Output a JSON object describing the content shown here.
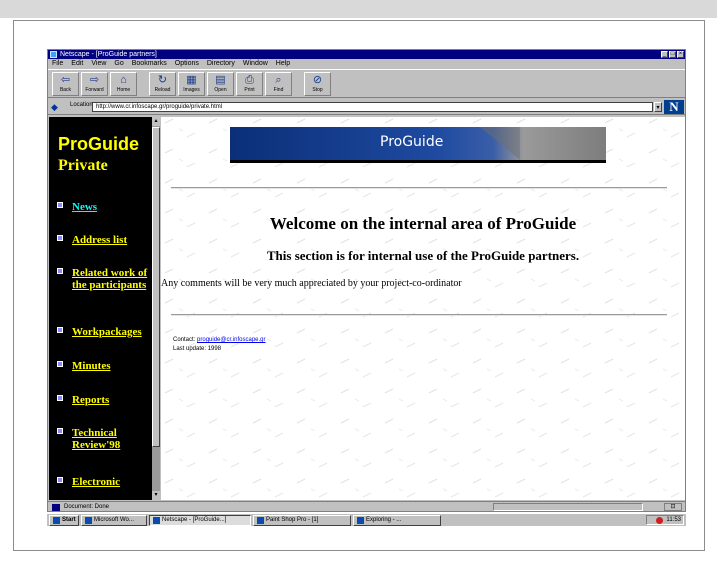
{
  "window": {
    "title": "Netscape - [ProGuide partners]",
    "controls": [
      "_",
      "□",
      "×"
    ]
  },
  "menu": [
    "File",
    "Edit",
    "View",
    "Go",
    "Bookmarks",
    "Options",
    "Directory",
    "Window",
    "Help"
  ],
  "toolbar": {
    "buttons": [
      {
        "label": "Back",
        "icon": "back-arrow-icon",
        "glyph": "⇦"
      },
      {
        "label": "Forward",
        "icon": "forward-arrow-icon",
        "glyph": "⇨"
      },
      {
        "label": "Home",
        "icon": "home-icon",
        "glyph": "⌂"
      },
      {
        "label": "Reload",
        "icon": "reload-icon",
        "glyph": "↻"
      },
      {
        "label": "Images",
        "icon": "images-icon",
        "glyph": "▦"
      },
      {
        "label": "Open",
        "icon": "open-icon",
        "glyph": "▤"
      },
      {
        "label": "Print",
        "icon": "print-icon",
        "glyph": "⎙"
      },
      {
        "label": "Find",
        "icon": "find-icon",
        "glyph": "⌕"
      },
      {
        "label": "Stop",
        "icon": "stop-icon",
        "glyph": "⊘"
      }
    ]
  },
  "location": {
    "label": "Location:",
    "url": "http://www.cr.infoscape.gr/proguide/private.html",
    "logo": "N"
  },
  "sidebar": {
    "title_line1": "ProGuide",
    "title_line2": "Private",
    "items": [
      {
        "label": "News",
        "active": true
      },
      {
        "label": "Address list",
        "active": false
      },
      {
        "label": "Related work of the participants",
        "active": false
      },
      {
        "label": "Workpackages",
        "active": false
      },
      {
        "label": "Minutes",
        "active": false
      },
      {
        "label": "Reports",
        "active": false
      },
      {
        "label": "Technical Review'98",
        "active": false
      },
      {
        "label": "Electronic",
        "active": false
      }
    ]
  },
  "content": {
    "banner_text": "ProGuide",
    "heading": "Welcome on the internal area of ProGuide",
    "subheading": "This section is for internal use of the ProGuide partners.",
    "paragraph": "Any comments will be very much appreciated by your project-co-ordinator",
    "contact_label": "Contact:",
    "contact_email": "proguide@cr.infoscape.gr",
    "updated": "Last update: 1998"
  },
  "statusbar": {
    "text": "Document: Done",
    "security": "⊡"
  },
  "taskbar": {
    "start": "Start",
    "tasks": [
      {
        "label": "Microsoft Wo...",
        "pressed": false
      },
      {
        "label": "Netscape - [ProGuide...]",
        "pressed": true
      },
      {
        "label": "Paint Shop Pro - [1]",
        "pressed": false
      },
      {
        "label": "Exploring - ...",
        "pressed": false
      }
    ],
    "clock": "11:53"
  },
  "colors": {
    "title_bar": "#000080",
    "sidebar_bg": "#000000",
    "sidebar_link": "#ffff00",
    "sidebar_active_link": "#00ffff",
    "banner_blue": "#1e4aa0"
  }
}
